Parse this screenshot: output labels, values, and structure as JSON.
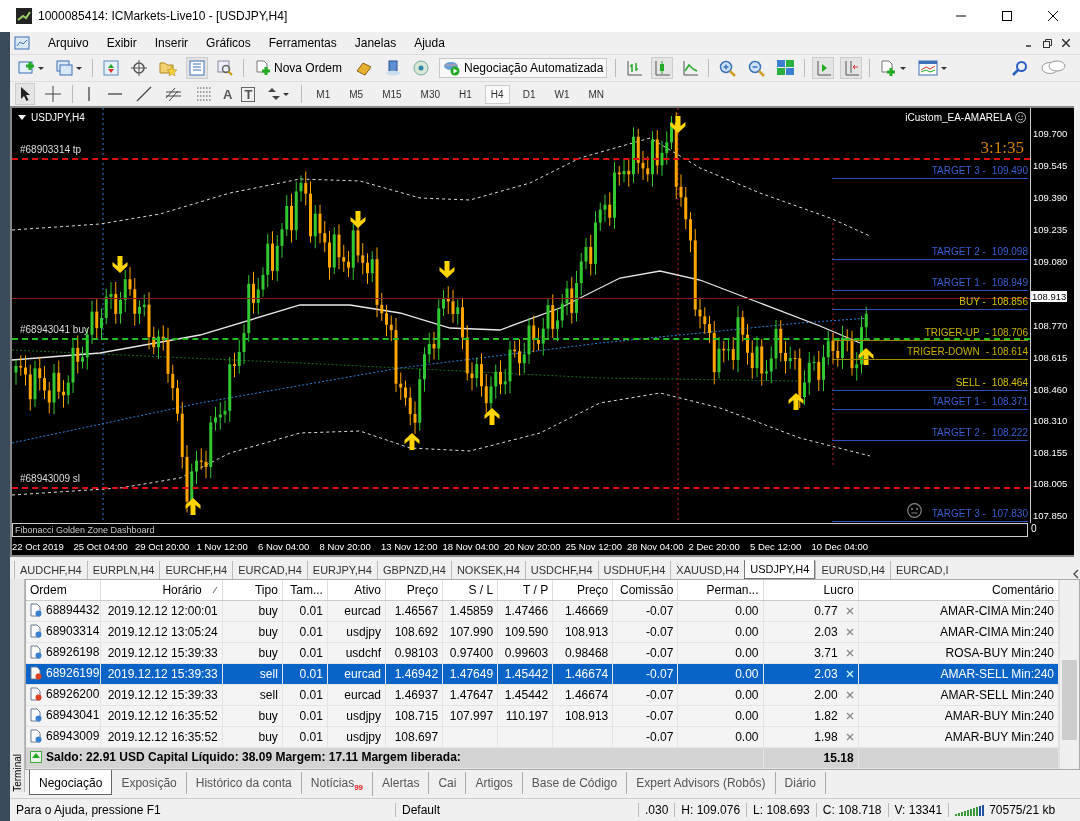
{
  "window": {
    "title": "1000085414: ICMarkets-Live10 - [USDJPY,H4]"
  },
  "menu": [
    "Arquivo",
    "Exibir",
    "Inserir",
    "Gráficos",
    "Ferramentas",
    "Janelas",
    "Ajuda"
  ],
  "toolbar": {
    "new_order": "Nova Ordem",
    "auto_trading": "Negociação Automatizada",
    "text_tool": "A",
    "label_tool": "T",
    "timeframes": [
      {
        "label": "M1",
        "selected": false
      },
      {
        "label": "M5",
        "selected": false
      },
      {
        "label": "M15",
        "selected": false
      },
      {
        "label": "M30",
        "selected": false
      },
      {
        "label": "H1",
        "selected": false
      },
      {
        "label": "H4",
        "selected": true
      },
      {
        "label": "D1",
        "selected": false
      },
      {
        "label": "W1",
        "selected": false
      },
      {
        "label": "MN",
        "selected": false
      }
    ]
  },
  "chart": {
    "symbol": "USDJPY,H4",
    "indicator": "iCustom_EA-AMARELA",
    "timer": "3:1:35",
    "subwindow": "Fibonacci Golden Zone Dashboard",
    "subwindow_scale": "0",
    "current_price": "108.913",
    "price_ticks": [
      "109.700",
      "109.545",
      "109.390",
      "109.235",
      "109.080",
      "108.770",
      "108.615",
      "108.460",
      "108.310",
      "108.155",
      "108.005",
      "107.850"
    ],
    "dates": [
      "22 Oct 2019",
      "25 Oct 04:00",
      "29 Oct 20:00",
      "1 Nov 12:00",
      "6 Nov 04:00",
      "8 Nov 20:00",
      "13 Nov 12:00",
      "18 Nov 04:00",
      "20 Nov 20:00",
      "25 Nov 12:00",
      "28 Nov 04:00",
      "2 Dec 20:00",
      "5 Dec 12:00",
      "10 Dec 04:00"
    ],
    "levels": [
      {
        "kind": "target",
        "label": "TARGET 3 -",
        "value": "109.490"
      },
      {
        "kind": "target",
        "label": "TARGET 2 -",
        "value": "109.098"
      },
      {
        "kind": "target",
        "label": "TARGET 1 -",
        "value": "108.949"
      },
      {
        "kind": "entry",
        "label": "BUY -",
        "value": "108.856"
      },
      {
        "kind": "trigger",
        "label": "TRIGER-UP",
        "value": "- 108.706"
      },
      {
        "kind": "trigger",
        "label": "TRIGER-DOWN",
        "value": "- 108.614"
      },
      {
        "kind": "entry",
        "label": "SELL -",
        "value": "108.464"
      },
      {
        "kind": "target",
        "label": "TARGET 1 -",
        "value": "108.371"
      },
      {
        "kind": "target",
        "label": "TARGET 2 -",
        "value": "108.222"
      },
      {
        "kind": "target",
        "label": "TARGET 3 -",
        "value": "107.830"
      }
    ],
    "order_lines": [
      {
        "kind": "tp",
        "label": "#68903314 tp"
      },
      {
        "kind": "buy",
        "label": "#68943041 buy"
      },
      {
        "kind": "sl",
        "label": "#68943009 sl"
      }
    ]
  },
  "symbol_tabs": [
    {
      "label": "AUDCHF,H4",
      "selected": false
    },
    {
      "label": "EURPLN,H4",
      "selected": false
    },
    {
      "label": "EURCHF,H4",
      "selected": false
    },
    {
      "label": "EURCAD,H4",
      "selected": false
    },
    {
      "label": "EURJPY,H4",
      "selected": false
    },
    {
      "label": "GBPNZD,H4",
      "selected": false
    },
    {
      "label": "NOKSEK,H4",
      "selected": false
    },
    {
      "label": "USDCHF,H4",
      "selected": false
    },
    {
      "label": "USDHUF,H4",
      "selected": false
    },
    {
      "label": "XAUUSD,H4",
      "selected": false
    },
    {
      "label": "USDJPY,H4",
      "selected": true
    },
    {
      "label": "EURUSD,H4",
      "selected": false
    },
    {
      "label": "EURCAD,I",
      "selected": false
    }
  ],
  "terminal": {
    "side_label": "Terminal",
    "columns": [
      "Ordem",
      "Horário",
      "Tipo",
      "Tam...",
      "Ativo",
      "Preço",
      "S / L",
      "T / P",
      "Preço",
      "Comissão",
      "Perman...",
      "Lucro",
      "Comentário"
    ],
    "rows": [
      {
        "ticket": "68894432",
        "time": "2019.12.12 12:00:01",
        "type": "buy",
        "size": "0.01",
        "symbol": "eurcad",
        "price": "1.46567",
        "sl": "1.45859",
        "tp": "1.47466",
        "current": "1.46669",
        "commission": "-0.07",
        "swap": "0.00",
        "profit": "0.77",
        "comment": "AMAR-CIMA Min:240",
        "selected": false
      },
      {
        "ticket": "68903314",
        "time": "2019.12.12 13:05:24",
        "type": "buy",
        "size": "0.01",
        "symbol": "usdjpy",
        "price": "108.692",
        "sl": "107.990",
        "tp": "109.590",
        "current": "108.913",
        "commission": "-0.07",
        "swap": "0.00",
        "profit": "2.03",
        "comment": "AMAR-CIMA Min:240",
        "selected": false
      },
      {
        "ticket": "68926198",
        "time": "2019.12.12 15:39:33",
        "type": "buy",
        "size": "0.01",
        "symbol": "usdchf",
        "price": "0.98103",
        "sl": "0.97400",
        "tp": "0.99603",
        "current": "0.98468",
        "commission": "-0.07",
        "swap": "0.00",
        "profit": "3.71",
        "comment": "ROSA-BUY Min:240",
        "selected": false
      },
      {
        "ticket": "68926199",
        "time": "2019.12.12 15:39:33",
        "type": "sell",
        "size": "0.01",
        "symbol": "eurcad",
        "price": "1.46942",
        "sl": "1.47649",
        "tp": "1.45442",
        "current": "1.46674",
        "commission": "-0.07",
        "swap": "0.00",
        "profit": "2.03",
        "comment": "AMAR-SELL Min:240",
        "selected": true
      },
      {
        "ticket": "68926200",
        "time": "2019.12.12 15:39:33",
        "type": "sell",
        "size": "0.01",
        "symbol": "eurcad",
        "price": "1.46937",
        "sl": "1.47647",
        "tp": "1.45442",
        "current": "1.46674",
        "commission": "-0.07",
        "swap": "0.00",
        "profit": "2.00",
        "comment": "AMAR-SELL Min:240",
        "selected": false
      },
      {
        "ticket": "68943041",
        "time": "2019.12.12 16:35:52",
        "type": "buy",
        "size": "0.01",
        "symbol": "usdjpy",
        "price": "108.715",
        "sl": "107.997",
        "tp": "110.197",
        "current": "108.913",
        "commission": "-0.07",
        "swap": "0.00",
        "profit": "1.82",
        "comment": "AMAR-BUY Min:240",
        "selected": false
      },
      {
        "ticket": "68943009",
        "time": "2019.12.12 16:35:52",
        "type": "buy",
        "size": "0.01",
        "symbol": "usdjpy",
        "price": "108.697",
        "commission": "-0.07",
        "swap": "0.00",
        "profit": "1.98",
        "comment": "AMAR-BUY Min:240",
        "selected": false
      }
    ],
    "summary": "Saldo: 22.91 USD  Capital Líquido: 38.09  Margem: 17.11  Margem liberada:",
    "total_profit": "15.18",
    "tabs": [
      {
        "label": "Negociação",
        "selected": true
      },
      {
        "label": "Exposição",
        "selected": false
      },
      {
        "label": "Histórico da conta",
        "selected": false
      },
      {
        "label": "Notícias",
        "selected": false,
        "badge": "99"
      },
      {
        "label": "Alertas",
        "selected": false
      },
      {
        "label": "Cai",
        "selected": false
      },
      {
        "label": "Artigos",
        "selected": false
      },
      {
        "label": "Base de Código",
        "selected": false
      },
      {
        "label": "Expert Advisors (Robôs)",
        "selected": false
      },
      {
        "label": "Diário",
        "selected": false
      }
    ]
  },
  "status_bar": {
    "help": "Para o Ajuda, pressione F1",
    "profile": "Default",
    "open": ".030",
    "high": "H: 109.076",
    "low": "L: 108.693",
    "close": "C: 108.718",
    "volume": "V: 13341",
    "traffic": "70575/21 kb"
  }
}
